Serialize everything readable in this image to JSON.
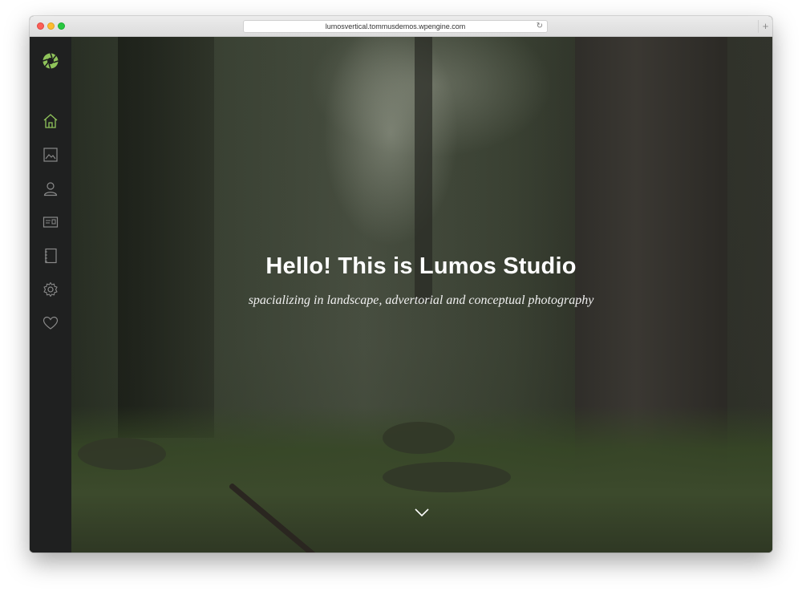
{
  "browser": {
    "url": "lumosvertical.tommusdemos.wpengine.com",
    "reload_icon": "reload-icon",
    "new_tab_label": "+"
  },
  "colors": {
    "accent": "#8fc35a",
    "sidebar_bg": "#1f2020",
    "icon_gray": "#8a8a8a"
  },
  "sidebar": {
    "logo_icon": "aperture-logo-icon",
    "items": [
      {
        "icon": "home-icon",
        "active": true
      },
      {
        "icon": "gallery-icon",
        "active": false
      },
      {
        "icon": "user-icon",
        "active": false
      },
      {
        "icon": "contact-card-icon",
        "active": false
      },
      {
        "icon": "notebook-icon",
        "active": false
      },
      {
        "icon": "gear-icon",
        "active": false
      },
      {
        "icon": "heart-icon",
        "active": false
      }
    ]
  },
  "hero": {
    "title": "Hello! This is Lumos Studio",
    "subtitle": "spacializing in landscape, advertorial and conceptual photography",
    "scroll_icon": "chevron-down-icon"
  }
}
